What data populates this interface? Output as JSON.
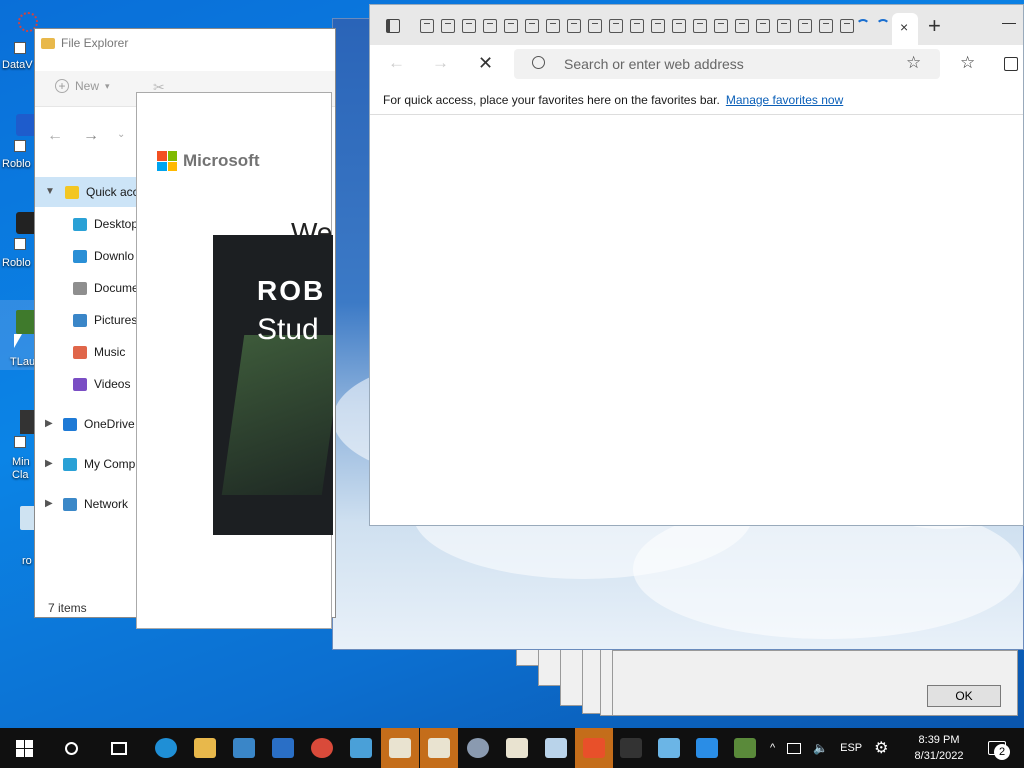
{
  "desktop": {
    "icons": [
      "DataV",
      "Roblo",
      "Roblo",
      "TLau",
      "Min Cla",
      "ro"
    ]
  },
  "explorer": {
    "title": "File Explorer",
    "new_label": "New",
    "nav_items": [
      {
        "label": "Quick acc",
        "icon": "star-icon",
        "color": "#f3c623"
      },
      {
        "label": "Desktop",
        "icon": "desktop-icon",
        "color": "#2aa1d6"
      },
      {
        "label": "Downlo",
        "icon": "download-icon",
        "color": "#2a8fd6"
      },
      {
        "label": "Docume",
        "icon": "document-icon",
        "color": "#8e8e8e"
      },
      {
        "label": "Pictures",
        "icon": "pictures-icon",
        "color": "#3a86c8"
      },
      {
        "label": "Music",
        "icon": "music-icon",
        "color": "#e0664a"
      },
      {
        "label": "Videos",
        "icon": "videos-icon",
        "color": "#7a4ec4"
      },
      {
        "label": "OneDrive",
        "icon": "cloud-icon",
        "color": "#1e7ad6"
      },
      {
        "label": "My Comp",
        "icon": "computer-icon",
        "color": "#2aa1d6"
      },
      {
        "label": "Network",
        "icon": "network-icon",
        "color": "#3b88c8"
      }
    ],
    "status": "7 items"
  },
  "installer": {
    "brand": "Microsoft",
    "heading_fragment": "We",
    "roblox_line1": "ROB",
    "roblox_line2": "Stud"
  },
  "edge": {
    "search_placeholder": "Search or enter web address",
    "favorites_text": "For quick access, place your favorites here on the favorites bar.",
    "manage_link": "Manage favorites now",
    "tab_count": 21
  },
  "dialog": {
    "ok_label": "OK"
  },
  "taskbar": {
    "lang": "ESP",
    "time": "8:39 PM",
    "date": "8/31/2022",
    "notification_count": "2"
  }
}
